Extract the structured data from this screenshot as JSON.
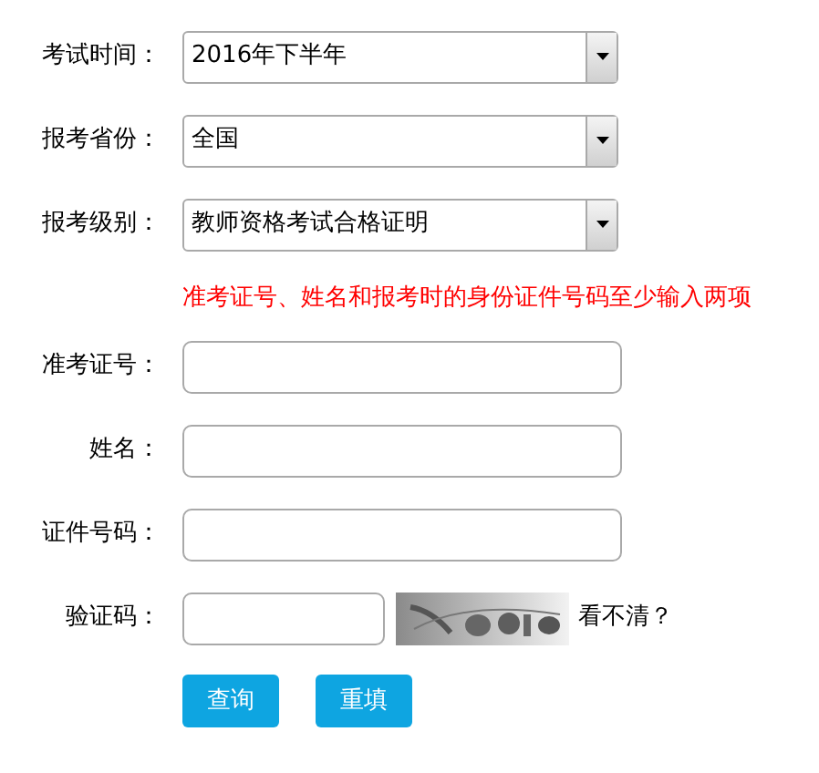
{
  "selects": [
    {
      "label": "考试时间：",
      "value": "2016年下半年"
    },
    {
      "label": "报考省份：",
      "value": "全国"
    },
    {
      "label": "报考级别：",
      "value": "教师资格考试合格证明"
    }
  ],
  "notice": "准考证号、姓名和报考时的身份证件号码至少输入两项",
  "inputs": [
    {
      "label": "准考证号："
    },
    {
      "label": "姓名："
    },
    {
      "label": "证件号码："
    }
  ],
  "captcha": {
    "label": "验证码：",
    "refresh_link": "看不清？"
  },
  "buttons": [
    "查询",
    "重填"
  ]
}
